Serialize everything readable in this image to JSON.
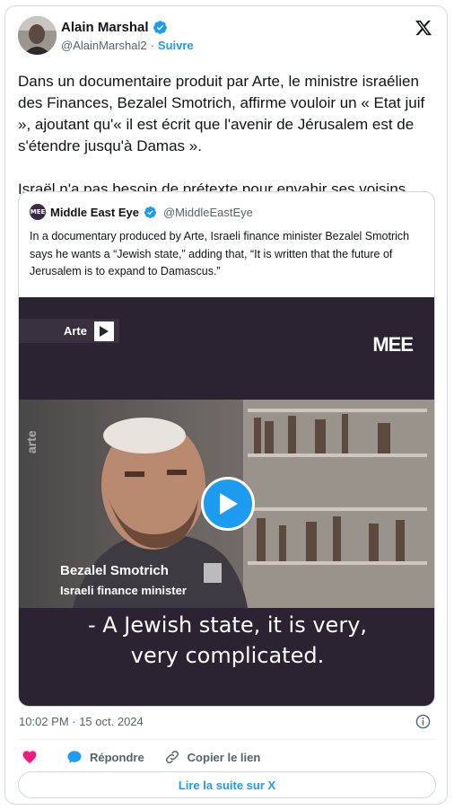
{
  "author": {
    "name": "Alain Marshal",
    "handle": "@AlainMarshal2",
    "separator": "·",
    "follow_label": "Suivre"
  },
  "tweet": {
    "text": "Dans un documentaire produit par Arte, le ministre israélien des Finances, Bezalel Smotrich, affirme vouloir un « Etat juif », ajoutant qu'« il est écrit que l'avenir de Jérusalem est de s'étendre jusqu'à Damas ».\n\nIsraël n'a pas besoin de prétexte pour envahir ses voisins…"
  },
  "quote": {
    "name": "Middle East Eye",
    "handle": "@MiddleEastEye",
    "avatar_text": "MEE",
    "text": "In a documentary produced by Arte, Israeli finance minister Bezalel Smotrich says he wants a “Jewish state,” adding that, “It is written that the future of Jerusalem is to expand to Damascus.”",
    "video": {
      "source_tag": "Arte",
      "brand_logo": "MEE",
      "watermark": "arte",
      "speaker_name": "Bezalel Smotrich",
      "speaker_role": "Israeli finance minister",
      "subtitle_line1": "- A Jewish state, it is very,",
      "subtitle_line2": "very complicated."
    }
  },
  "footer": {
    "timestamp": "10:02 PM · 15 oct. 2024",
    "reply_label": "Répondre",
    "copy_label": "Copier le lien",
    "read_more_label": "Lire la suite sur X"
  },
  "colors": {
    "accent": "#1d9bf0",
    "heart": "#f91880",
    "muted": "#536471",
    "video_bg": "#2b2331"
  },
  "icons": [
    "verified-badge-icon",
    "x-logo-icon",
    "play-icon",
    "info-icon",
    "heart-icon",
    "reply-bubble-icon",
    "link-icon"
  ]
}
